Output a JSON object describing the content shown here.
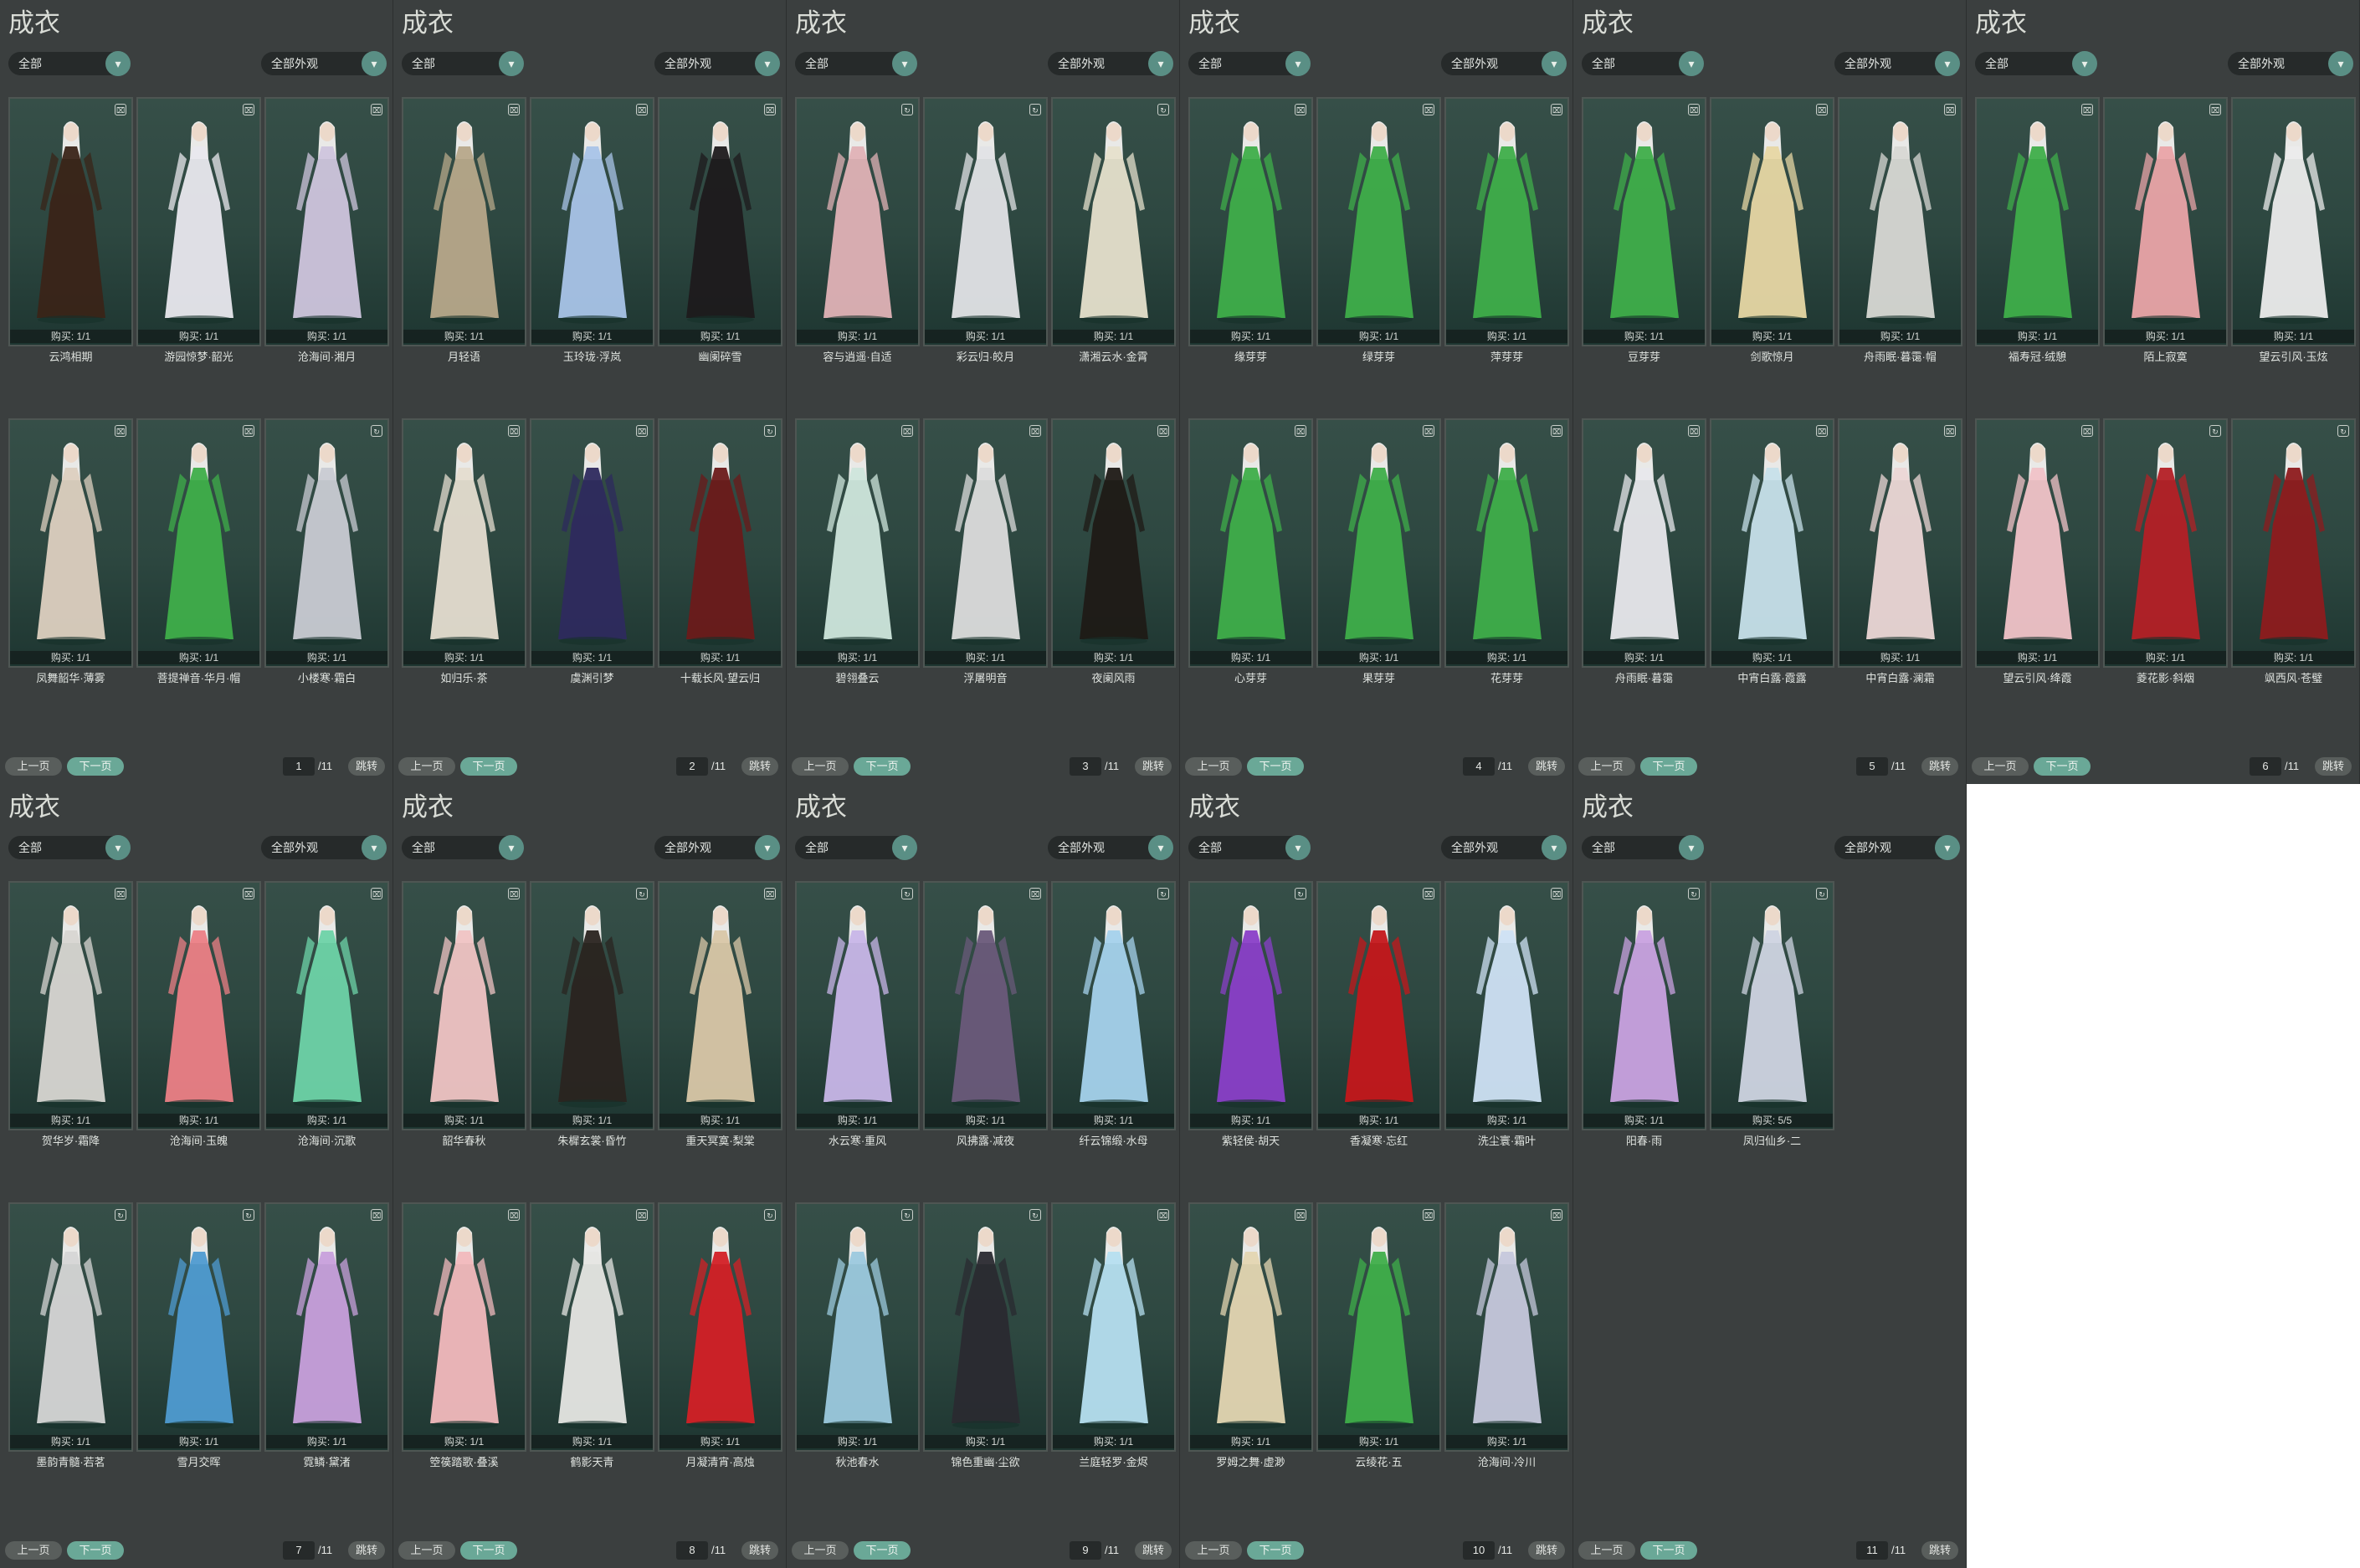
{
  "common": {
    "title": "成衣",
    "filter1": "全部",
    "filter2": "全部外观",
    "prev": "上一页",
    "next": "下一页",
    "jump": "跳转",
    "page_suffix": "/11"
  },
  "colors": {
    "panel_bg": "#3b3f3f",
    "card_bg": "#2d4740",
    "accent": "#6aa897",
    "text": "#dfe3df"
  },
  "panels": [
    {
      "page": "1",
      "items": [
        {
          "name": "云鸿相期",
          "buy": "购买: 1/1",
          "icon": "trash-icon",
          "tint": "#3a2418"
        },
        {
          "name": "游园惊梦·韶光",
          "buy": "购买: 1/1",
          "icon": "trash-icon",
          "tint": "#e9e8ee"
        },
        {
          "name": "沧海间·湘月",
          "buy": "购买: 1/1",
          "icon": "trash-icon",
          "tint": "#cfc5dd"
        },
        {
          "name": "凤舞韶华·薄雾",
          "buy": "购买: 1/1",
          "icon": "trash-icon",
          "tint": "#ddd0c0"
        },
        {
          "name": "菩提禅音·华月·帽",
          "buy": "购买: 1/1",
          "icon": "trash-icon",
          "tint": "#3fae4a"
        },
        {
          "name": "小楼寒·霜白",
          "buy": "购买: 1/1",
          "icon": "refresh-icon",
          "tint": "#c9cbd3"
        }
      ]
    },
    {
      "page": "2",
      "items": [
        {
          "name": "月轻语",
          "buy": "购买: 1/1",
          "icon": "trash-icon",
          "tint": "#b7a88a"
        },
        {
          "name": "玉玲珑·浮岚",
          "buy": "购买: 1/1",
          "icon": "trash-icon",
          "tint": "#a9c4e8"
        },
        {
          "name": "幽阑碎雪",
          "buy": "购买: 1/1",
          "icon": "trash-icon",
          "tint": "#1e1a1c"
        },
        {
          "name": "如归乐·茶",
          "buy": "购买: 1/1",
          "icon": "trash-icon",
          "tint": "#e5ddd0"
        },
        {
          "name": "虞渊引梦",
          "buy": "购买: 1/1",
          "icon": "trash-icon",
          "tint": "#2e2a5e"
        },
        {
          "name": "十载长风·望云归",
          "buy": "购买: 1/1",
          "icon": "refresh-icon",
          "tint": "#6b1a1a"
        }
      ]
    },
    {
      "page": "3",
      "items": [
        {
          "name": "容与逍遥·自适",
          "buy": "购买: 1/1",
          "icon": "refresh-icon",
          "tint": "#e0b2b6"
        },
        {
          "name": "彩云归·皎月",
          "buy": "购买: 1/1",
          "icon": "refresh-icon",
          "tint": "#e2e3e6"
        },
        {
          "name": "潇湘云水·金霄",
          "buy": "购买: 1/1",
          "icon": "refresh-icon",
          "tint": "#e6e0cc"
        },
        {
          "name": "碧翎叠云",
          "buy": "购买: 1/1",
          "icon": "trash-icon",
          "tint": "#cfe6dc"
        },
        {
          "name": "浮屠明音",
          "buy": "购买: 1/1",
          "icon": "trash-icon",
          "tint": "#dcdcdc"
        },
        {
          "name": "夜阑风雨",
          "buy": "购买: 1/1",
          "icon": "trash-icon",
          "tint": "#1f1a16"
        }
      ]
    },
    {
      "page": "4",
      "items": [
        {
          "name": "缘芽芽",
          "buy": "购买: 1/1",
          "icon": "trash-icon",
          "tint": "#3fae4a"
        },
        {
          "name": "绿芽芽",
          "buy": "购买: 1/1",
          "icon": "trash-icon",
          "tint": "#3fae4a"
        },
        {
          "name": "萍芽芽",
          "buy": "购买: 1/1",
          "icon": "trash-icon",
          "tint": "#3fae4a"
        },
        {
          "name": "心芽芽",
          "buy": "购买: 1/1",
          "icon": "trash-icon",
          "tint": "#3fae4a"
        },
        {
          "name": "果芽芽",
          "buy": "购买: 1/1",
          "icon": "trash-icon",
          "tint": "#3fae4a"
        },
        {
          "name": "花芽芽",
          "buy": "购买: 1/1",
          "icon": "trash-icon",
          "tint": "#3fae4a"
        }
      ]
    },
    {
      "page": "5",
      "items": [
        {
          "name": "豆芽芽",
          "buy": "购买: 1/1",
          "icon": "trash-icon",
          "tint": "#3fae4a"
        },
        {
          "name": "剑歌惊月",
          "buy": "购买: 1/1",
          "icon": "trash-icon",
          "tint": "#e7d7a4"
        },
        {
          "name": "舟雨眠·暮霭·帽",
          "buy": "购买: 1/1",
          "icon": "trash-icon",
          "tint": "#d8d8d4"
        },
        {
          "name": "舟雨眠·暮霭",
          "buy": "购买: 1/1",
          "icon": "trash-icon",
          "tint": "#e8e8ec"
        },
        {
          "name": "中宵白露·霞露",
          "buy": "购买: 1/1",
          "icon": "trash-icon",
          "tint": "#c7e0ea"
        },
        {
          "name": "中宵白露·澜霜",
          "buy": "购买: 1/1",
          "icon": "trash-icon",
          "tint": "#ecd7d6"
        }
      ]
    },
    {
      "page": "6",
      "items": [
        {
          "name": "福寿冠·绒憩",
          "buy": "购买: 1/1",
          "icon": "trash-icon",
          "tint": "#3fae4a"
        },
        {
          "name": "陌上寂寞",
          "buy": "购买: 1/1",
          "icon": "trash-icon",
          "tint": "#eaa4a8"
        },
        {
          "name": "望云引风·玉炫",
          "buy": "购买: 1/1",
          "icon": "",
          "tint": "#ececec"
        },
        {
          "name": "望云引风·绛霞",
          "buy": "购买: 1/1",
          "icon": "trash-icon",
          "tint": "#f1c3c8"
        },
        {
          "name": "菱花影·斜烟",
          "buy": "购买: 1/1",
          "icon": "refresh-icon",
          "tint": "#b42026"
        },
        {
          "name": "飒西风·苍璧",
          "buy": "购买: 1/1",
          "icon": "refresh-icon",
          "tint": "#8e1b1d"
        }
      ]
    },
    {
      "page": "7",
      "items": [
        {
          "name": "贺华岁·霜降",
          "buy": "购买: 1/1",
          "icon": "trash-icon",
          "tint": "#d8d6d2"
        },
        {
          "name": "沧海间·玉魄",
          "buy": "购买: 1/1",
          "icon": "trash-icon",
          "tint": "#ec7f86"
        },
        {
          "name": "沧海间·沉歌",
          "buy": "购买: 1/1",
          "icon": "trash-icon",
          "tint": "#6ed3a8"
        },
        {
          "name": "墨韵青髓·若茗",
          "buy": "购买: 1/1",
          "icon": "refresh-icon",
          "tint": "#d6d6d6"
        },
        {
          "name": "雪月交晖",
          "buy": "购买: 1/1",
          "icon": "refresh-icon",
          "tint": "#4f9bd1"
        },
        {
          "name": "霓鳞·黛渚",
          "buy": "购买: 1/1",
          "icon": "trash-icon",
          "tint": "#c8a0dc"
        }
      ]
    },
    {
      "page": "8",
      "items": [
        {
          "name": "韶华春秋",
          "buy": "购买: 1/1",
          "icon": "trash-icon",
          "tint": "#f0c4c4"
        },
        {
          "name": "朱樨玄裳·昏竹",
          "buy": "购买: 1/1",
          "icon": "refresh-icon",
          "tint": "#2a2420"
        },
        {
          "name": "重天冥寞·梨棠",
          "buy": "购买: 1/1",
          "icon": "trash-icon",
          "tint": "#d9c7a8"
        },
        {
          "name": "箜篌踏歌·叠溪",
          "buy": "购买: 1/1",
          "icon": "trash-icon",
          "tint": "#f2b9bd"
        },
        {
          "name": "鹤影天青",
          "buy": "购买: 1/1",
          "icon": "trash-icon",
          "tint": "#e6e6e3"
        },
        {
          "name": "月凝清宵·高烛",
          "buy": "购买: 1/1",
          "icon": "refresh-icon",
          "tint": "#d32026"
        }
      ]
    },
    {
      "page": "9",
      "items": [
        {
          "name": "水云寒·重风",
          "buy": "购买: 1/1",
          "icon": "refresh-icon",
          "tint": "#c8b6e8"
        },
        {
          "name": "风拂露·减夜",
          "buy": "购买: 1/1",
          "icon": "trash-icon",
          "tint": "#6a5a7a"
        },
        {
          "name": "纤云锦缎·水母",
          "buy": "购买: 1/1",
          "icon": "refresh-icon",
          "tint": "#a5d2ec"
        },
        {
          "name": "秋池春水",
          "buy": "购买: 1/1",
          "icon": "refresh-icon",
          "tint": "#9cc9de"
        },
        {
          "name": "锦色重幽·尘欲",
          "buy": "购买: 1/1",
          "icon": "refresh-icon",
          "tint": "#2a2a30"
        },
        {
          "name": "兰庭轻罗·金烬",
          "buy": "购买: 1/1",
          "icon": "trash-icon",
          "tint": "#b6dff0"
        }
      ]
    },
    {
      "page": "10",
      "items": [
        {
          "name": "紫轻侯·胡天",
          "buy": "购买: 1/1",
          "icon": "refresh-icon",
          "tint": "#8a3fc8"
        },
        {
          "name": "香凝寒·忘红",
          "buy": "购买: 1/1",
          "icon": "trash-icon",
          "tint": "#c4171b"
        },
        {
          "name": "洗尘寰·霜叶",
          "buy": "购买: 1/1",
          "icon": "trash-icon",
          "tint": "#cfe2f4"
        },
        {
          "name": "罗姆之舞·虚渺",
          "buy": "购买: 1/1",
          "icon": "trash-icon",
          "tint": "#e4d6b2"
        },
        {
          "name": "云绫花·五",
          "buy": "购买: 1/1",
          "icon": "trash-icon",
          "tint": "#3fae4a"
        },
        {
          "name": "沧海间·冷川",
          "buy": "购买: 1/1",
          "icon": "trash-icon",
          "tint": "#c6c8dc"
        }
      ]
    },
    {
      "page": "11",
      "items": [
        {
          "name": "阳春·雨",
          "buy": "购买: 1/1",
          "icon": "refresh-icon",
          "tint": "#c9a2e0"
        },
        {
          "name": "凤归仙乡·二",
          "buy": "购买: 5/5",
          "icon": "refresh-icon",
          "tint": "#cfd4e2"
        }
      ]
    }
  ]
}
